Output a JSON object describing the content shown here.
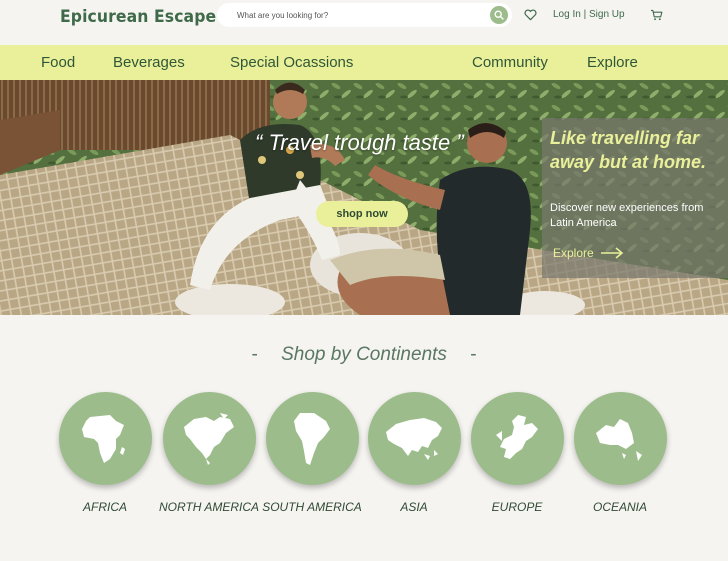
{
  "header": {
    "logo": "Epicurean Escape",
    "search_placeholder": "What are you looking for?",
    "login_label": "Log In",
    "separator": "|",
    "signup_label": "Sign Up"
  },
  "nav": {
    "items": [
      "Food",
      "Beverages",
      "Special Ocassions",
      "Community",
      "Explore"
    ]
  },
  "hero": {
    "quote": "“ Travel trough taste ”",
    "shop_now": "shop now",
    "promo_heading": "Like travelling far away but at home.",
    "promo_text": "Discover new experiences from Latin America",
    "promo_explore": "Explore"
  },
  "section": {
    "title": "Shop by Continents",
    "dash": "-"
  },
  "continents": [
    {
      "label": "AFRICA",
      "icon": "africa-map-icon"
    },
    {
      "label": "NORTH AMERICA",
      "icon": "north-america-map-icon"
    },
    {
      "label": "SOUTH AMERICA",
      "icon": "south-america-map-icon"
    },
    {
      "label": "ASIA",
      "icon": "asia-map-icon"
    },
    {
      "label": "EUROPE",
      "icon": "europe-map-icon"
    },
    {
      "label": "OCEANIA",
      "icon": "oceania-map-icon"
    }
  ],
  "colors": {
    "background": "#f5f4f0",
    "brand_green": "#3f6a4a",
    "nav_yellow": "#eaf09a",
    "continent_green": "#9cbd8b",
    "promo_overlay": "#78786e"
  }
}
